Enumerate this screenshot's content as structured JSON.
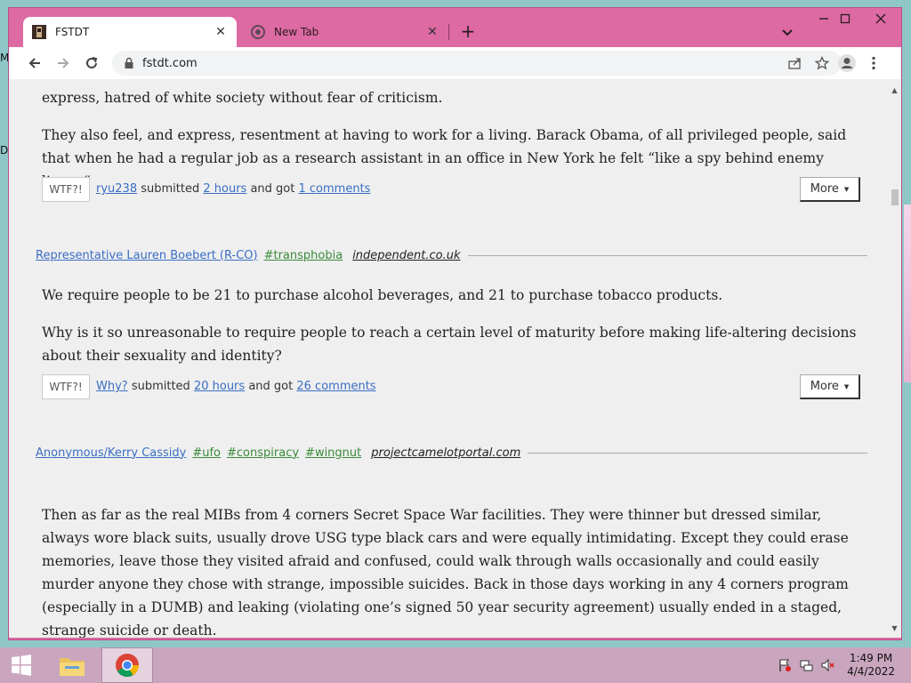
{
  "desktop": {
    "glyph_top": "M",
    "glyph_bottom": "D"
  },
  "tabs": [
    {
      "title": "FSTDT",
      "active": true
    },
    {
      "title": "New Tab",
      "active": false
    }
  ],
  "toolbar": {
    "url": "fstdt.com"
  },
  "posts": {
    "first_tail": {
      "paragraphs": [
        "express, hatred of white society without fear of criticism.",
        "They also feel, and express, resentment at having to work for a living. Barack Obama, of all privileged people, said that when he had a regular job as a research assistant in an office in New York he felt “like a spy behind enemy lines. “"
      ],
      "wtf_label": "WTF?!",
      "user": "ryu238",
      "submitted": "submitted",
      "time": "2 hours",
      "and_got": "and got",
      "comments": "1 comments",
      "more_label": "More"
    },
    "second": {
      "author": "Representative Lauren Boebert (R-CO)",
      "tags": [
        "#transphobia"
      ],
      "source": "independent.co.uk",
      "paragraphs": [
        "We require people to be 21 to purchase alcohol beverages, and 21 to purchase tobacco products.",
        "Why is it so unreasonable to require people to reach a certain level of maturity before making life-altering decisions about their sexuality and identity?"
      ],
      "wtf_label": "WTF?!",
      "user": "Why?",
      "submitted": "submitted",
      "time": "20 hours",
      "and_got": "and got",
      "comments": "26 comments",
      "more_label": "More"
    },
    "third": {
      "author": "Anonymous/Kerry Cassidy",
      "tags": [
        "#ufo",
        "#conspiracy",
        "#wingnut"
      ],
      "source": "projectcamelotportal.com",
      "paragraphs": [
        "Then as far as the real MIBs from 4 corners Secret Space War facilities. They were thinner but dressed similar, always wore black suits, usually drove USG type black cars and were equally intimidating. Except they could erase memories, leave those they visited afraid and confused, could walk through walls occasionally and could easily murder anyone they chose with strange, impossible suicides. Back in those days working in any 4 corners program (especially in a DUMB) and leaking (violating one’s signed 50 year security agreement) usually ended in a staged, strange suicide or death."
      ]
    }
  },
  "taskbar": {
    "time": "1:49 PM",
    "date": "4/4/2022"
  }
}
